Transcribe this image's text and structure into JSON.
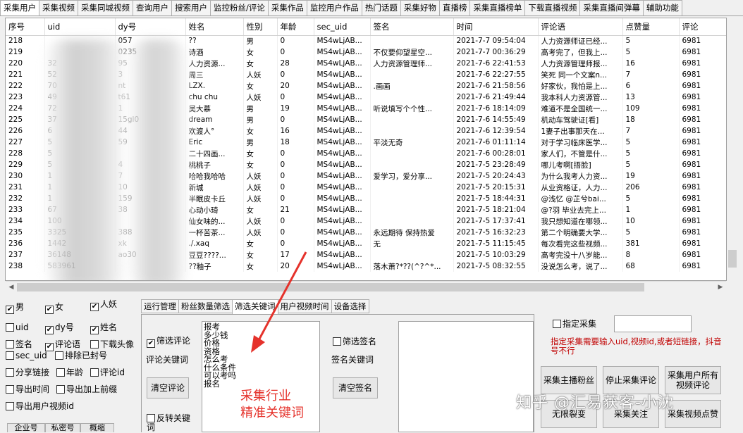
{
  "tabs": [
    "采集用户",
    "采集视频",
    "采集同城视频",
    "查询用户",
    "搜索用户",
    "监控粉丝/评论",
    "采集作品",
    "监控用户作品",
    "热门话题",
    "采集好物",
    "直播榜",
    "采集直播榜单",
    "下载直播视频",
    "采集直播间弹幕",
    "辅助功能"
  ],
  "table": {
    "columns": [
      "序号",
      "uid",
      "dy号",
      "姓名",
      "性别",
      "年龄",
      "sec_uid",
      "签名",
      "时间",
      "评论语",
      "点赞量",
      "评论"
    ],
    "rows": [
      [
        "218",
        "",
        "057",
        "??",
        "男",
        "0",
        "MS4wLjAB...",
        "",
        "2021-7-7 09:54:04",
        "人力资源师证已经...",
        "5",
        "6981"
      ],
      [
        "219",
        "",
        "0235",
        "诗酒",
        "女",
        "0",
        "MS4wLjAB...",
        "不仅要仰望星空...",
        "2021-7-7 00:36:29",
        "高考完了，但我上...",
        "5",
        "6981"
      ],
      [
        "220",
        "32",
        "95",
        "人力资源...",
        "女",
        "28",
        "MS4wLjAB...",
        "人力资源管理师...",
        "2021-7-6 22:41:53",
        "人力资源管理师报...",
        "16",
        "6981"
      ],
      [
        "221",
        "52",
        "3",
        "周三",
        "人妖",
        "0",
        "MS4wLjAB...",
        "",
        "2021-7-6 22:27:55",
        "笑死 同一个文案n...",
        "7",
        "6981"
      ],
      [
        "222",
        "70",
        "nt",
        "LZX.",
        "女",
        "20",
        "MS4wLjAB...",
        ".画画",
        "2021-7-6 21:58:56",
        "好家伙，我怕是上...",
        "6",
        "6981"
      ],
      [
        "223",
        "49",
        "t61",
        "chu  chu",
        "人妖",
        "0",
        "MS4wLjAB...",
        "",
        "2021-7-6 21:49:44",
        "我本科人力资源管...",
        "13",
        "6981"
      ],
      [
        "224",
        "72",
        "1",
        "吴大慕",
        "男",
        "19",
        "MS4wLjAB...",
        "听说填写个个性...",
        "2021-7-6 18:14:09",
        "难道不是全国统一...",
        "109",
        "6981"
      ],
      [
        "225",
        "37",
        "15gl0",
        "dream",
        "男",
        "0",
        "MS4wLjAB...",
        "",
        "2021-7-6 14:55:49",
        "机动车驾驶证[看]",
        "18",
        "6981"
      ],
      [
        "226",
        "6",
        "44",
        "欢渡人°",
        "女",
        "16",
        "MS4wLjAB...",
        "",
        "2021-7-6 12:39:54",
        "1妻子出事那天在...",
        "7",
        "6981"
      ],
      [
        "227",
        "5",
        "59",
        "Eric",
        "男",
        "18",
        "MS4wLjAB...",
        "平淡无奇",
        "2021-7-6 01:11:14",
        "对于学习临床医学...",
        "5",
        "6981"
      ],
      [
        "228",
        "5",
        "",
        "二十四画...",
        "女",
        "0",
        "MS4wLjAB...",
        "",
        "2021-7-6 00:28:01",
        "家人们，不管是什...",
        "5",
        "6981"
      ],
      [
        "229",
        "5",
        "4",
        "桃桃子",
        "女",
        "0",
        "MS4wLjAB...",
        "",
        "2021-7-5 23:28:49",
        "哪儿考啊[捂脸]",
        "5",
        "6981"
      ],
      [
        "230",
        "1",
        "7",
        "哈哈我哈哈",
        "人妖",
        "0",
        "MS4wLjAB...",
        "爱学习，爱分享...",
        "2021-7-5 20:24:43",
        "为什么我考人力资...",
        "19",
        "6981"
      ],
      [
        "231",
        "1",
        "10",
        "新城",
        "人妖",
        "0",
        "MS4wLjAB...",
        "",
        "2021-7-5 20:15:31",
        "从业资格证，人力...",
        "206",
        "6981"
      ],
      [
        "232",
        "1",
        "159",
        "半眠皮卡丘",
        "人妖",
        "0",
        "MS4wLjAB...",
        "",
        "2021-7-5 18:44:31",
        "@浅忆 @芷兮bai...",
        "5",
        "6981"
      ],
      [
        "233",
        "67",
        "38",
        "心动小琦",
        "女",
        "21",
        "MS4wLjAB...",
        "",
        "2021-7-5 18:21:04",
        "@?羽 毕业去完上...",
        "1",
        "6981"
      ],
      [
        "234",
        "100",
        "",
        "仙女味的...",
        "人妖",
        "0",
        "MS4wLjAB...",
        "",
        "2021-7-5 17:37:41",
        "我只想知道在哪领...",
        "10",
        "6981"
      ],
      [
        "235",
        "3325",
        "388",
        "一杯苦茶...",
        "人妖",
        "0",
        "MS4wLjAB...",
        "永远期待 保持热爱",
        "2021-7-5 16:32:23",
        "第二个明确要大学...",
        "5",
        "6981"
      ],
      [
        "236",
        "1442",
        "xk",
        "./.xaq",
        "女",
        "0",
        "MS4wLjAB...",
        "无",
        "2021-7-5 11:15:45",
        "每次看完这些视频...",
        "381",
        "6981"
      ],
      [
        "237",
        "36148",
        "ao30",
        "豆豆????...",
        "女",
        "17",
        "MS4wLjAB...",
        "",
        "2021-7-5 10:03:29",
        "高考完没十八岁能...",
        "8",
        "6981"
      ],
      [
        "238",
        "583961",
        "",
        "??釉子",
        "女",
        "20",
        "MS4wLjAB...",
        "落木萧?*??(^?^*...",
        "2021-7-5 08:32:55",
        "没说怎么考，说了...",
        "68",
        "6981"
      ]
    ]
  },
  "filters": {
    "male": "男",
    "female": "女",
    "other": "人妖",
    "uid": "uid",
    "dy": "dy号",
    "name": "姓名",
    "sign": "签名",
    "comment": "评论语",
    "download_avatar": "下载头像",
    "sec_uid": "sec_uid",
    "exclude_banned": "排除已封号",
    "share_link": "分享链接",
    "age": "年龄",
    "comment_id": "评论id",
    "export_time": "导出时间",
    "export_prefix": "导出加上前缀",
    "export_video_id": "导出用户视频id"
  },
  "bottom_tabs": [
    "企业号",
    "私密号",
    "概缩"
  ],
  "sub_tabs": [
    "运行管理",
    "粉丝数量筛选",
    "筛选关键词",
    "用户视频时间",
    "设备选择"
  ],
  "keyword_panel": {
    "filter_comment": "筛选评论",
    "comment_keyword_label": "评论关键词",
    "clear_comment": "清空评论",
    "reverse_keyword": "反转关键词",
    "keywords": [
      "报考",
      "多少钱",
      "价格",
      "资格",
      "怎么考",
      "什么条件",
      "可以考吗",
      "报名"
    ],
    "filter_sign": "筛选签名",
    "sign_keyword_label": "签名关键词",
    "clear_sign": "清空签名"
  },
  "annotation": {
    "line1": "采集行业",
    "line2": "精准关键词",
    "arrow_color": "#e5322b"
  },
  "right_panel": {
    "target_collect": "指定采集",
    "target_value": "",
    "hint": "指定采集需要输入uid,视频id,或者短链接，抖音号不行",
    "btn_collect_live_fans": "采集主播粉丝",
    "btn_stop_comment": "停止采集评论",
    "btn_collect_all_video_comments": "采集用户所有视频评论",
    "btn_infinite_split": "无限裂变",
    "btn_collect_follow": "采集关注",
    "btn_collect_video_likes": "采集视频点赞"
  },
  "watermark": "知乎 @汇易获客-小沈"
}
